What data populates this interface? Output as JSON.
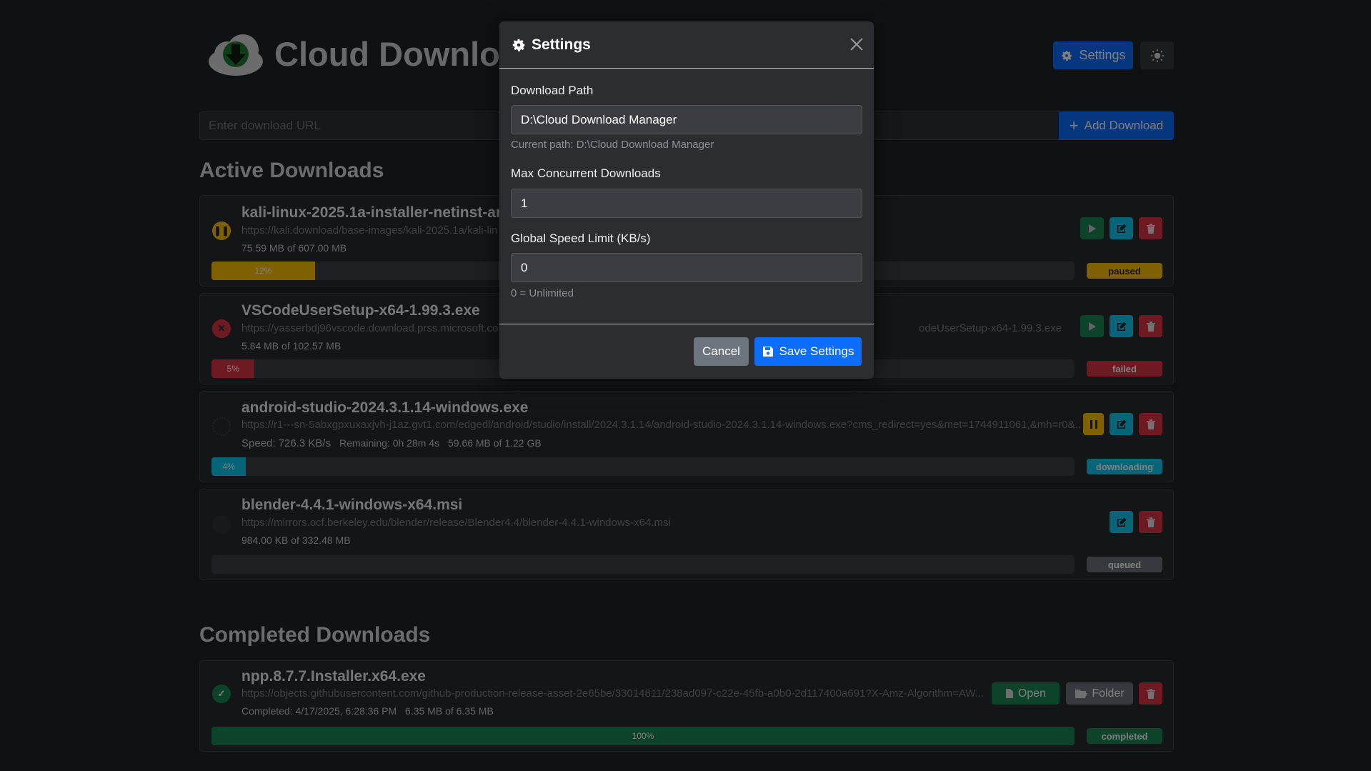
{
  "header": {
    "app_title": "Cloud Download",
    "settings_label": "Settings"
  },
  "url_bar": {
    "placeholder": "Enter download URL",
    "add_label": "Add Download"
  },
  "active_section": {
    "title": "Active Downloads"
  },
  "active_downloads": [
    {
      "name": "kali-linux-2025.1a-installer-netinst-am",
      "url": "https://kali.download/base-images/kali-2025.1a/kali-lin",
      "size": "75.59 MB of 607.00 MB",
      "progress_label": "12%",
      "progress": 12,
      "status": "paused",
      "status_color": "#ffc107"
    },
    {
      "name": "VSCodeUserSetup-x64-1.99.3.exe",
      "url": "https://yasserbdj96vscode.download.prss.microsoft.com/dbazure/download/stable/.../VSCodeUserSetup-x64-1.99.3.exe",
      "url_left": "https://yasserbdj96vscode.download.prss.microsoft.com",
      "url_right": "odeUserSetup-x64-1.99.3.exe",
      "size": "5.84 MB of 102.57 MB",
      "progress_label": "5%",
      "progress": 5,
      "status": "failed",
      "status_color": "#dc3545"
    },
    {
      "name": "android-studio-2024.3.1.14-windows.exe",
      "url": "https://r1---sn-5abxgpxuxaxjvh-j1az.gvt1.com/edgedl/android/studio/install/2024.3.1.14/android-studio-2024.3.1.14-windows.exe?cms_redirect=yes&met=1744911061,&mh=r0&...",
      "speed": "Speed: 726.3 KB/s",
      "remaining": "Remaining: 0h 28m 4s",
      "size": "59.66 MB of 1.22 GB",
      "progress_label": "4%",
      "progress": 4,
      "status": "downloading",
      "status_color": "#0dcaf0"
    },
    {
      "name": "blender-4.4.1-windows-x64.msi",
      "url": "https://mirrors.ocf.berkeley.edu/blender/release/Blender4.4/blender-4.4.1-windows-x64.msi",
      "size": "984.00 KB of 332.48 MB",
      "progress_label": "",
      "progress": 0,
      "status": "queued",
      "status_color": "#6c757d"
    }
  ],
  "completed_section": {
    "title": "Completed Downloads"
  },
  "completed_downloads": [
    {
      "name": "npp.8.7.7.Installer.x64.exe",
      "url": "https://objects.githubusercontent.com/github-production-release-asset-2e65be/33014811/238ad097-c22e-45fb-a0b0-2d117400a691?X-Amz-Algorithm=AW...",
      "completed": "Completed: 4/17/2025, 6:28:36 PM",
      "size": "6.35 MB of 6.35 MB",
      "progress_label": "100%",
      "progress": 100,
      "status": "completed",
      "status_color": "#198754",
      "open_label": "Open",
      "folder_label": "Folder"
    }
  ],
  "modal": {
    "title": "Settings",
    "path_label": "Download Path",
    "path_value": "D:\\Cloud Download Manager",
    "path_help": "Current path: D:\\Cloud Download Manager",
    "concurrent_label": "Max Concurrent Downloads",
    "concurrent_value": "1",
    "speed_label": "Global Speed Limit (KB/s)",
    "speed_value": "0",
    "speed_help": "0 = Unlimited",
    "cancel_label": "Cancel",
    "save_label": "Save Settings"
  },
  "colors": {
    "primary": "#0d6efd",
    "success": "#198754",
    "danger": "#dc3545",
    "warning": "#ffc107",
    "info": "#0dcaf0",
    "secondary": "#6c757d"
  }
}
